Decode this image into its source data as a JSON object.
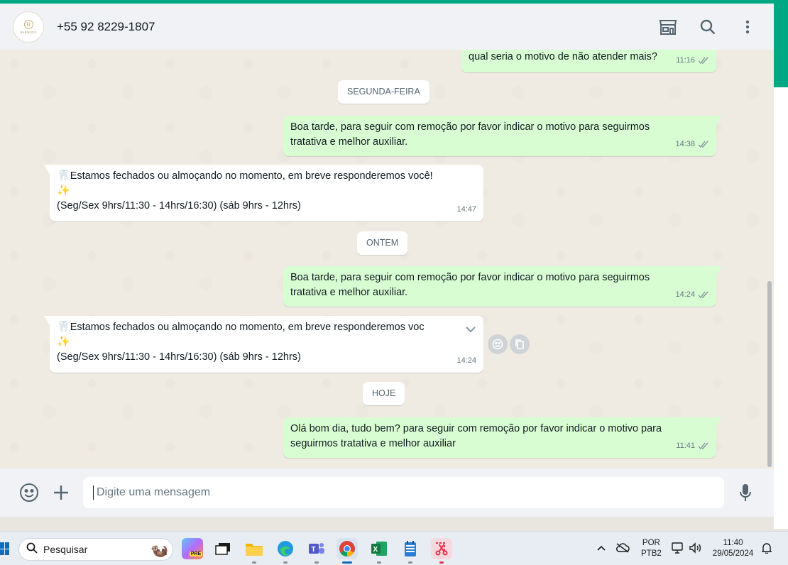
{
  "header": {
    "avatar_monogram": "H",
    "avatar_brand": "HARMONY",
    "contact_name": "+55 92 8229-1807"
  },
  "messages": {
    "m1": {
      "text": "qual seria o motivo de não atender mais?",
      "time": "11:16"
    },
    "day1": "SEGUNDA-FEIRA",
    "m2": {
      "text": "Boa tarde, para seguir com remoção por favor indicar o motivo para seguirmos tratativa e melhor auxiliar.",
      "time": "14:38"
    },
    "m3": {
      "tooth": "🦷",
      "line1": "Estamos fechados  ou almoçando  no momento, em breve responderemos você!",
      "sparkle": "✨",
      "line2": "(Seg/Sex 9hrs/11:30 - 14hrs/16:30) (sáb 9hrs - 12hrs)",
      "time": "14:47"
    },
    "day2": "ONTEM",
    "m4": {
      "text": "Boa tarde, para seguir com remoção por favor indicar o motivo para seguirmos tratativa e melhor auxiliar.",
      "time": "14:24"
    },
    "m5": {
      "tooth": "🦷",
      "line1": "Estamos fechados  ou almoçando  no momento, em breve responderemos voc",
      "sparkle": "✨",
      "line2": "(Seg/Sex 9hrs/11:30 - 14hrs/16:30) (sáb 9hrs - 12hrs)",
      "time": "14:24"
    },
    "day3": "HOJE",
    "m6": {
      "text": "Olá bom dia, tudo bem? para seguir com remoção por favor indicar o motivo para seguirmos tratativa e melhor auxiliar",
      "time": "11:41"
    }
  },
  "composer": {
    "placeholder": "Digite uma mensagem"
  },
  "taskbar": {
    "search_label": "Pesquisar",
    "copilot_badge": "PRE",
    "lang_line1": "POR",
    "lang_line2": "PTB2",
    "time": "11:40",
    "date": "29/05/2024"
  },
  "colors": {
    "accent": "#00a884",
    "outgoing_bubble": "#d9fdd3",
    "incoming_bubble": "#ffffff",
    "chat_background": "#efeae2"
  }
}
